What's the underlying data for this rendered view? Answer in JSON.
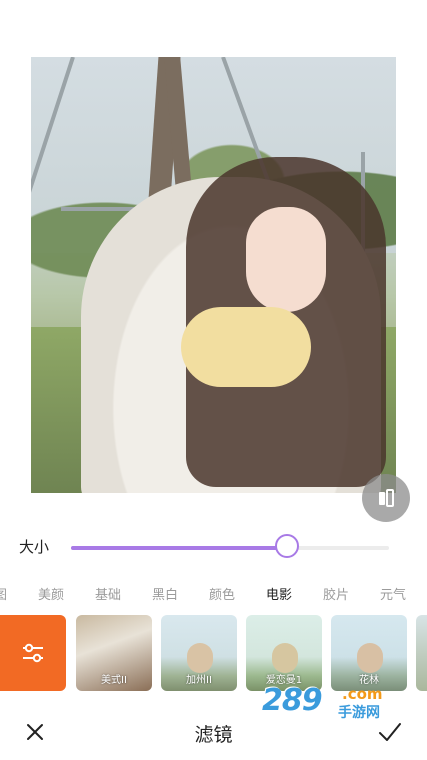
{
  "colors": {
    "accent": "#a87ae6",
    "adjust_tile": "#f26a24",
    "tab_active": "#222222",
    "tab_inactive": "#9b9b9b"
  },
  "slider": {
    "label": "大小",
    "value": 0.68
  },
  "tabs": [
    {
      "label": "图",
      "active": false
    },
    {
      "label": "美颜",
      "active": false
    },
    {
      "label": "基础",
      "active": false
    },
    {
      "label": "黑白",
      "active": false
    },
    {
      "label": "颜色",
      "active": false
    },
    {
      "label": "电影",
      "active": true
    },
    {
      "label": "胶片",
      "active": false
    },
    {
      "label": "元气",
      "active": false
    }
  ],
  "filters": [
    {
      "label": "",
      "icon": "sliders-icon"
    },
    {
      "label": "美式II"
    },
    {
      "label": "加州II"
    },
    {
      "label": "爱恋曼1"
    },
    {
      "label": "花林"
    },
    {
      "label": ""
    }
  ],
  "watermark": {
    "number": "289",
    "domain": ".com",
    "name": "手游网"
  },
  "bottom_bar": {
    "title": "滤镜",
    "close_icon": "close-icon",
    "confirm_icon": "check-icon"
  },
  "compare_icon": "compare-icon"
}
